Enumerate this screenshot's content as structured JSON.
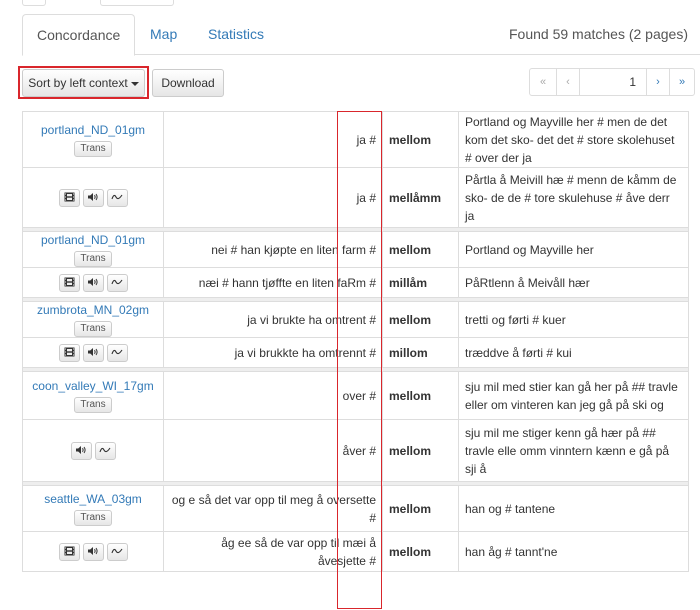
{
  "tabs": [
    {
      "label": "Concordance",
      "active": true
    },
    {
      "label": "Map",
      "active": false
    },
    {
      "label": "Statistics",
      "active": false
    }
  ],
  "found_text": "Found 59 matches (2 pages)",
  "toolbar": {
    "sort_label": "Sort by left context",
    "download_label": "Download"
  },
  "pager": {
    "first": "«",
    "prev": "‹",
    "page": "1",
    "next": "›",
    "last": "»"
  },
  "trans_label": "Trans",
  "accent_color": "#337ab7",
  "highlight_color": "#d9262c",
  "rows": [
    {
      "speaker": "portland_ND_01gm",
      "left": "ja #",
      "match": "mellom",
      "right": "Portland og Mayville her # men de det kom det sko- det det # store skolehuset # over der ja"
    },
    {
      "left": "ja #",
      "match": "mellåmm",
      "right": "Pårtla å Meivill hæ # menn de kåmm de sko- de de # tore skulehuse # åve derr ja",
      "icons": [
        "film-icon",
        "speaker-icon",
        "waveform-icon"
      ]
    },
    {
      "speaker": "portland_ND_01gm",
      "left": "nei # han kjøpte en liten farm #",
      "match": "mellom",
      "right": "Portland og Mayville her"
    },
    {
      "left": "næi # hann tjøffte en liten faRm #",
      "match": "millåm",
      "right": "PåRtlenn å Meivåll hær",
      "icons": [
        "film-icon",
        "speaker-icon",
        "waveform-icon"
      ]
    },
    {
      "speaker": "zumbrota_MN_02gm",
      "left": "ja vi brukte ha omtrent #",
      "match": "mellom",
      "right": "tretti og førti # kuer"
    },
    {
      "left": "ja vi brukkte ha omtrennt #",
      "match": "millom",
      "right": "træddve å førti # kui",
      "icons": [
        "film-icon",
        "speaker-icon",
        "waveform-icon"
      ]
    },
    {
      "speaker": "coon_valley_WI_17gm",
      "left": "over #",
      "match": "mellom",
      "right": "sju mil med stier kan gå her på ## travle eller om vinteren kan jeg gå på ski og"
    },
    {
      "left": "åver #",
      "match": "mellom",
      "right": "sju mil me stiger kenn gå hær på ## travle elle omm vinntern kænn e gå på sji å",
      "icons": [
        "speaker-icon",
        "waveform-icon"
      ]
    },
    {
      "speaker": "seattle_WA_03gm",
      "left": "og e så det var opp til meg å oversette #",
      "match": "mellom",
      "right": "han og # tantene"
    },
    {
      "left": "åg ee så de var opp til mæi å åvesjette #",
      "match": "mellom",
      "right": "han åg # tannt'ne",
      "icons": [
        "film-icon",
        "speaker-icon",
        "waveform-icon"
      ]
    }
  ]
}
